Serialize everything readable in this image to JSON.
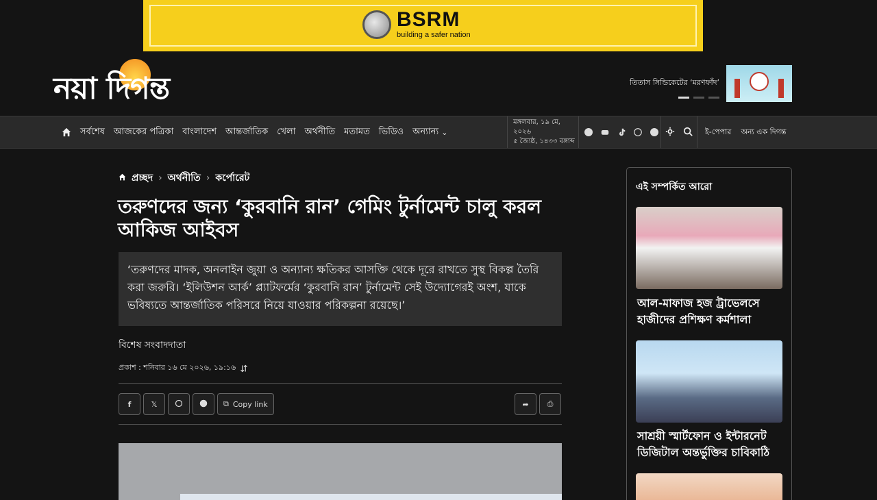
{
  "ad": {
    "brand": "BSRM",
    "tagline": "building a safer nation"
  },
  "site": {
    "logo_text": "নয়া দিগন্ত"
  },
  "promo": {
    "text": "তিতাস সিন্ডিকেটের ‘মরণফাঁদ’"
  },
  "nav": {
    "items": [
      "সর্বশেষ",
      "আজকের পত্রিকা",
      "বাংলাদেশ",
      "আন্তর্জাতিক",
      "খেলা",
      "অর্থনীতি",
      "মতামত",
      "ভিডিও",
      "অন্যান্য"
    ],
    "date_line1": "মঙ্গলবার, ১৯ মে, ২০২৬",
    "date_line2": "৫ জ্যৈষ্ঠ, ১৪৩৩ বঙ্গাব্দ",
    "epaper": "ই-পেপার",
    "other": "অন্য এক দিগন্ত"
  },
  "breadcrumb": {
    "home": "প্রচ্ছদ",
    "section": "অর্থনীতি",
    "subsection": "কর্পোরেট"
  },
  "article": {
    "title": "তরুণদের জন্য ‘কুরবানি রান’ গেমিং টুর্নামেন্ট চালু করল আকিজ আইবস",
    "summary": "‘তরুণদের মাদক, অনলাইন জুয়া ও অন্যান্য ক্ষতিকর আসক্তি থেকে দূরে রাখতে সুস্থ বিকল্প তৈরি করা জরুরি। ‘ইলিউশন আর্ক’ প্ল্যাটফর্মের ‘কুরবানি রান’ টুর্নামেন্ট সেই উদ্যোগেরই অংশ, যাকে ভবিষ্যতে আন্তর্জাতিক পরিসরে নিয়ে যাওয়ার পরিকল্পনা রয়েছে।’",
    "author": "বিশেষ সংবাদদাতা",
    "published": "প্রকাশ : শনিবার ১৬ মে ২০২৬, ১৯:১৬",
    "copy_link": "Copy link"
  },
  "sidebar": {
    "title": "এই সম্পর্কিত আরো",
    "items": [
      {
        "title": "আল-মাফাজ হজ ট্রাভেলসে হাজীদের প্রশিক্ষণ কর্মশালা"
      },
      {
        "title": "সাশ্রয়ী স্মার্টফোন ও ইন্টারনেট ডিজিটাল অন্তর্ভুক্তির চাবিকাঠি"
      }
    ]
  }
}
